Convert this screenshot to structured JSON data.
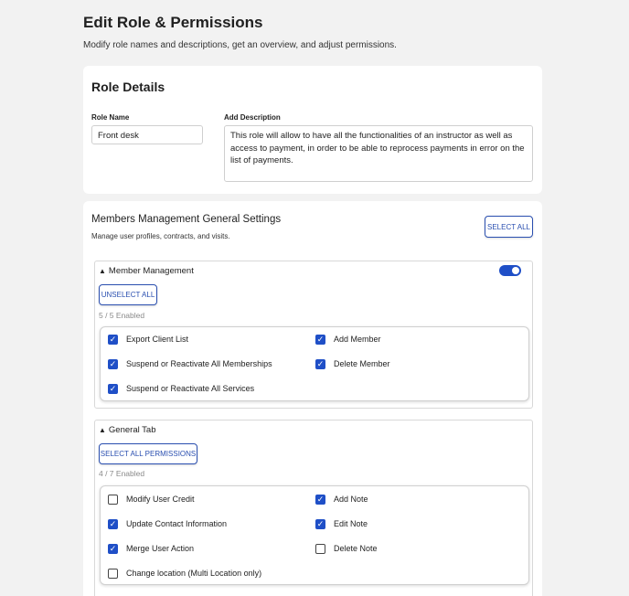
{
  "page": {
    "title": "Edit Role & Permissions",
    "subtitle": "Modify role names and descriptions, get an overview, and adjust permissions."
  },
  "role_details": {
    "title": "Role Details",
    "name_label": "Role Name",
    "name_value": "Front desk",
    "description_label": "Add Description",
    "description_value": "This role will allow to have all the functionalities of an instructor as well as access to payment, in order to be able to reprocess payments in error on the list of payments."
  },
  "members_section": {
    "title": "Members Management General Settings",
    "description": "Manage user profiles, contracts, and visits.",
    "select_all_label": "SELECT ALL",
    "groups": [
      {
        "title": "Member Management",
        "toggle_on": true,
        "button_label": "UNSELECT ALL",
        "count": "5 / 5  Enabled",
        "permissions": [
          {
            "label": "Export Client List",
            "checked": true
          },
          {
            "label": "Add Member",
            "checked": true
          },
          {
            "label": "Suspend or Reactivate All Memberships",
            "checked": true
          },
          {
            "label": "Delete Member",
            "checked": true
          },
          {
            "label": "Suspend or Reactivate All Services",
            "checked": true
          }
        ]
      },
      {
        "title": "General Tab",
        "button_label": "SELECT ALL PERMISSIONS",
        "count": "4 / 7  Enabled",
        "permissions": [
          {
            "label": "Modify User Credit",
            "checked": false
          },
          {
            "label": "Add Note",
            "checked": true
          },
          {
            "label": "Update Contact Information",
            "checked": true
          },
          {
            "label": "Edit Note",
            "checked": true
          },
          {
            "label": "Merge User Action",
            "checked": true
          },
          {
            "label": "Delete Note",
            "checked": false
          },
          {
            "label": "Change location (Multi Location only)",
            "checked": false
          }
        ]
      }
    ]
  },
  "colors": {
    "accent": "#1f4fc7",
    "background": "#f2f2f2"
  }
}
